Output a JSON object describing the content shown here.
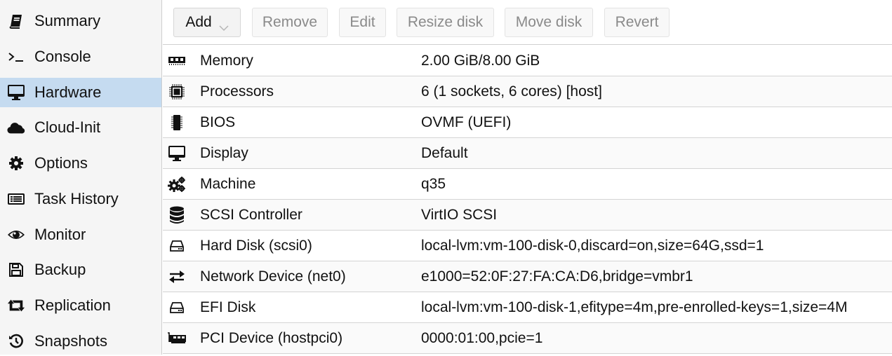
{
  "sidebar": {
    "items": [
      {
        "label": "Summary",
        "icon": "book-icon",
        "active": false
      },
      {
        "label": "Console",
        "icon": "terminal-icon",
        "active": false
      },
      {
        "label": "Hardware",
        "icon": "desktop-icon",
        "active": true
      },
      {
        "label": "Cloud-Init",
        "icon": "cloud-icon",
        "active": false
      },
      {
        "label": "Options",
        "icon": "gear-icon",
        "active": false
      },
      {
        "label": "Task History",
        "icon": "list-icon",
        "active": false
      },
      {
        "label": "Monitor",
        "icon": "eye-icon",
        "active": false
      },
      {
        "label": "Backup",
        "icon": "floppy-icon",
        "active": false
      },
      {
        "label": "Replication",
        "icon": "retweet-icon",
        "active": false
      },
      {
        "label": "Snapshots",
        "icon": "history-icon",
        "active": false
      }
    ]
  },
  "toolbar": {
    "add_label": "Add",
    "remove_label": "Remove",
    "edit_label": "Edit",
    "resize_label": "Resize disk",
    "move_label": "Move disk",
    "revert_label": "Revert"
  },
  "hardware": {
    "rows": [
      {
        "name": "Memory",
        "value": "2.00 GiB/8.00 GiB",
        "icon": "memory-icon"
      },
      {
        "name": "Processors",
        "value": "6 (1 sockets, 6 cores) [host]",
        "icon": "cpu-icon"
      },
      {
        "name": "BIOS",
        "value": "OVMF (UEFI)",
        "icon": "microchip-icon"
      },
      {
        "name": "Display",
        "value": "Default",
        "icon": "desktop-icon"
      },
      {
        "name": "Machine",
        "value": "q35",
        "icon": "cogs-icon"
      },
      {
        "name": "SCSI Controller",
        "value": "VirtIO SCSI",
        "icon": "database-icon"
      },
      {
        "name": "Hard Disk (scsi0)",
        "value": "local-lvm:vm-100-disk-0,discard=on,size=64G,ssd=1",
        "icon": "hdd-icon"
      },
      {
        "name": "Network Device (net0)",
        "value": "e1000=52:0F:27:FA:CA:D6,bridge=vmbr1",
        "icon": "exchange-icon"
      },
      {
        "name": "EFI Disk",
        "value": "local-lvm:vm-100-disk-1,efitype=4m,pre-enrolled-keys=1,size=4M",
        "icon": "hdd-icon"
      },
      {
        "name": "PCI Device (hostpci0)",
        "value": "0000:01:00,pcie=1",
        "icon": "pci-card-icon"
      }
    ]
  }
}
